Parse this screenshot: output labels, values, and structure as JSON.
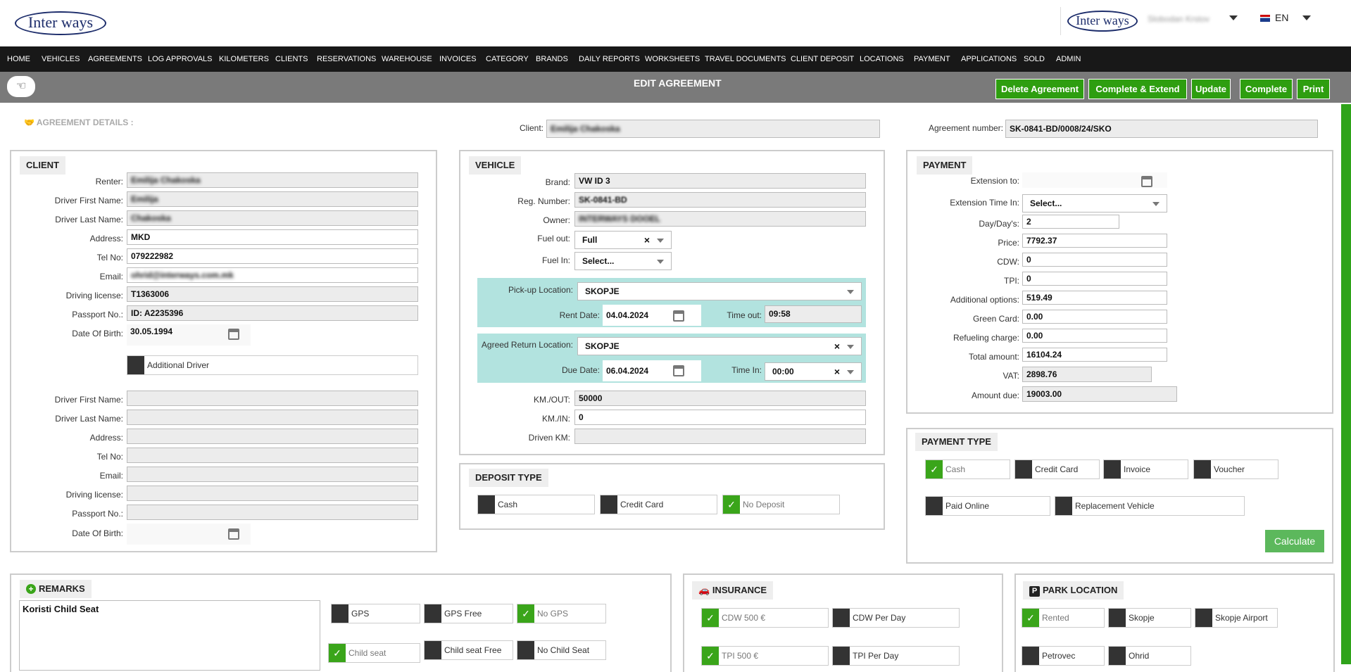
{
  "header": {
    "logo_text": "Inter ways",
    "user_name": "Slobodan Krstov",
    "language": "EN"
  },
  "nav": [
    "HOME",
    "VEHICLES",
    "AGREEMENTS",
    "LOG APPROVALS",
    "KILOMETERS",
    "CLIENTS",
    "RESERVATIONS",
    "WAREHOUSE",
    "INVOICES",
    "CATEGORY",
    "BRANDS",
    "DAILY REPORTS",
    "WORKSHEETS",
    "TRAVEL DOCUMENTS",
    "CLIENT DEPOSIT",
    "LOCATIONS",
    "PAYMENT",
    "APPLICATIONS",
    "SOLD",
    "ADMIN"
  ],
  "toolbar": {
    "title": "EDIT AGREEMENT",
    "buttons": [
      "Delete Agreement",
      "Complete & Extend",
      "Update",
      "Complete",
      "Print"
    ]
  },
  "details": {
    "heading": "AGREEMENT DETAILS :",
    "client_label": "Client:",
    "client_value": "Emilija  Chakoska",
    "agreement_label": "Agreement number:",
    "agreement_value": "SK-0841-BD/0008/24/SKO"
  },
  "client": {
    "title": "CLIENT",
    "fields": [
      {
        "label": "Renter:",
        "value": "Emilija  Chakoska"
      },
      {
        "label": "Driver First Name:",
        "value": "Emilija"
      },
      {
        "label": "Driver Last Name:",
        "value": "Chakoska"
      },
      {
        "label": "Address:",
        "value": "MKD"
      },
      {
        "label": "Tel No:",
        "value": "079222982"
      },
      {
        "label": "Email:",
        "value": "ohrid@interways.com.mk"
      },
      {
        "label": "Driving license:",
        "value": "T1363006"
      },
      {
        "label": "Passport No.:",
        "value": "ID: A2235396"
      },
      {
        "label": "Date Of Birth:",
        "value": "30.05.1994"
      }
    ],
    "additional_driver": "Additional Driver",
    "fields2": [
      "Driver First Name:",
      "Driver Last Name:",
      "Address:",
      "Tel No:",
      "Email:",
      "Driving license:",
      "Passport No.:",
      "Date Of Birth:"
    ]
  },
  "vehicle": {
    "title": "VEHICLE",
    "brand_label": "Brand:",
    "brand": "VW ID 3",
    "reg_label": "Reg. Number:",
    "reg": "SK-0841-BD",
    "owner_label": "Owner:",
    "owner": "INTERWAYS DOOEL",
    "fuel_out_label": "Fuel out:",
    "fuel_out": "Full",
    "x": "×",
    "fuel_in_label": "Fuel In:",
    "fuel_in": "Select...",
    "pickup_label": "Pick-up Location:",
    "pickup": "SKOPJE",
    "rent_date_label": "Rent Date:",
    "rent_date": "04.04.2024",
    "time_out_label": "Time out:",
    "time_out": "09:58",
    "return_label": "Agreed Return Location:",
    "return": "SKOPJE",
    "due_date_label": "Due Date:",
    "due_date": "06.04.2024",
    "time_in_label": "Time In:",
    "time_in": "00:00",
    "km_out_label": "KM./OUT:",
    "km_out": "50000",
    "km_in_label": "KM./IN:",
    "km_in": "0",
    "driven_label": "Driven KM:",
    "driven": ""
  },
  "deposit": {
    "title": "DEPOSIT TYPE",
    "options": [
      "Cash",
      "Credit Card",
      "No Deposit"
    ]
  },
  "payment": {
    "title": "PAYMENT",
    "ext_to_label": "Extension to:",
    "ext_time_label": "Extension Time In:",
    "ext_time": "Select...",
    "rows": [
      {
        "label": "Day/Day's:",
        "value": "2"
      },
      {
        "label": "Price:",
        "value": "7792.37"
      },
      {
        "label": "CDW:",
        "value": "0"
      },
      {
        "label": "TPI:",
        "value": "0"
      },
      {
        "label": "Additional options:",
        "value": "519.49"
      },
      {
        "label": "Green Card:",
        "value": "0.00"
      },
      {
        "label": "Refueling charge:",
        "value": "0.00"
      },
      {
        "label": "Total amount:",
        "value": "16104.24"
      },
      {
        "label": "VAT:",
        "value": "2898.76"
      },
      {
        "label": "Amount due:",
        "value": "19003.00"
      }
    ]
  },
  "payment_type": {
    "title": "PAYMENT TYPE",
    "options": [
      "Cash",
      "Credit Card",
      "Invoice",
      "Voucher",
      "Paid Online",
      "Replacement Vehicle"
    ],
    "calculate": "Calculate"
  },
  "remarks": {
    "title": "REMARKS",
    "text": "Koristi Child Seat",
    "options": [
      "GPS",
      "GPS Free",
      "No GPS",
      "Child seat",
      "Child seat Free",
      "No Child Seat"
    ]
  },
  "insurance": {
    "title": "INSURANCE",
    "options": [
      "CDW 500 €",
      "CDW Per Day",
      "TPI 500 €",
      "TPI Per Day"
    ]
  },
  "park": {
    "title": "PARK LOCATION",
    "options": [
      "Rented",
      "Skopje",
      "Skopje Airport",
      "Petrovec",
      "Ohrid"
    ]
  },
  "check_mark": "✓"
}
